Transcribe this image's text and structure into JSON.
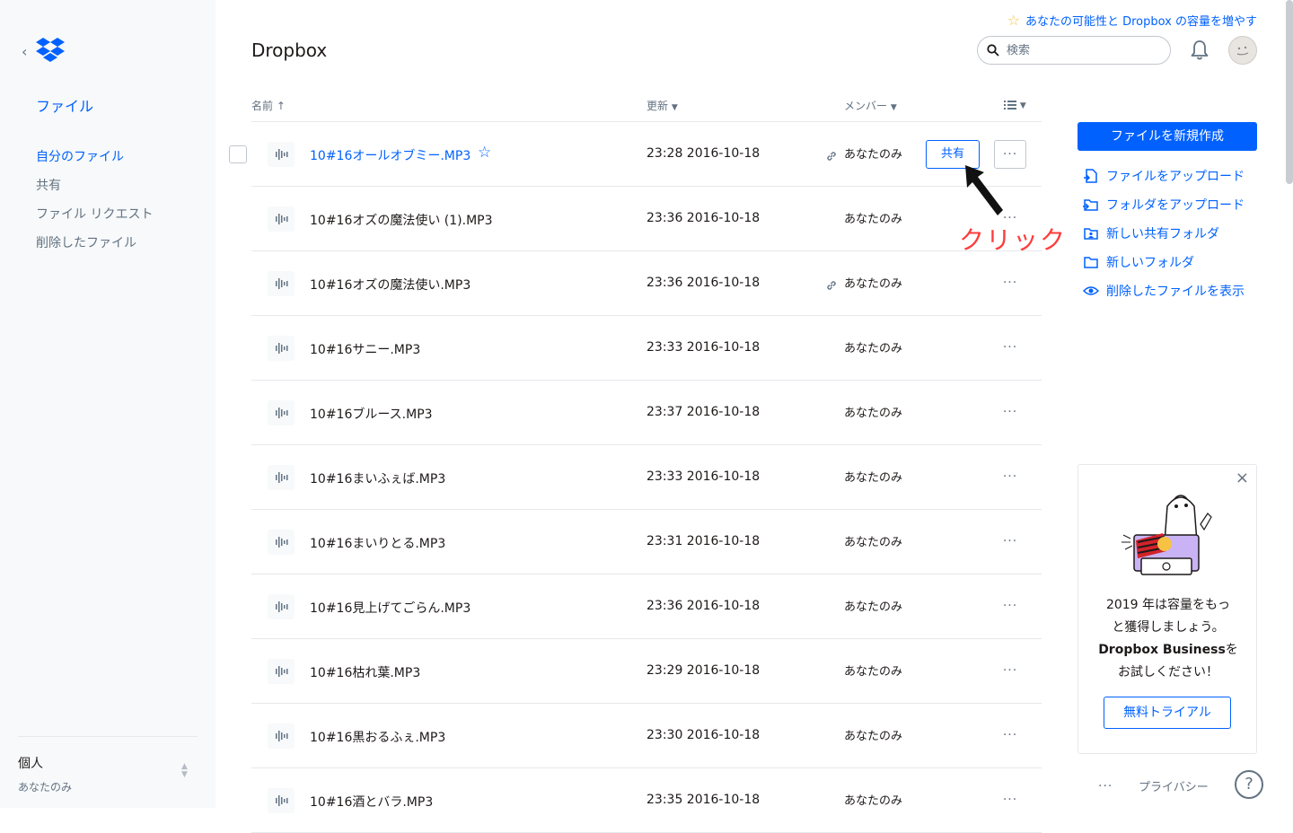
{
  "sidebar": {
    "title": "ファイル",
    "nav": [
      "自分のファイル",
      "共有",
      "ファイル リクエスト",
      "削除したファイル"
    ],
    "account_name": "個人",
    "account_sub": "あなたのみ"
  },
  "header": {
    "page_title": "Dropbox",
    "upsell": "あなたの可能性と Dropbox の容量を増やす",
    "search_placeholder": "検索"
  },
  "table": {
    "columns": {
      "name": "名前",
      "modified": "更新",
      "members": "メンバー"
    },
    "rows": [
      {
        "name": "10#16オールオブミー.MP3",
        "date": "23:28 2016-10-18",
        "member": "あなたのみ",
        "linked": true,
        "starred": true,
        "hover": true
      },
      {
        "name": "10#16オズの魔法使い (1).MP3",
        "date": "23:36 2016-10-18",
        "member": "あなたのみ",
        "linked": false
      },
      {
        "name": "10#16オズの魔法使い.MP3",
        "date": "23:36 2016-10-18",
        "member": "あなたのみ",
        "linked": true
      },
      {
        "name": "10#16サニー.MP3",
        "date": "23:33 2016-10-18",
        "member": "あなたのみ",
        "linked": false
      },
      {
        "name": "10#16ブルース.MP3",
        "date": "23:37 2016-10-18",
        "member": "あなたのみ",
        "linked": false
      },
      {
        "name": "10#16まいふぇば.MP3",
        "date": "23:33 2016-10-18",
        "member": "あなたのみ",
        "linked": false
      },
      {
        "name": "10#16まいりとる.MP3",
        "date": "23:31 2016-10-18",
        "member": "あなたのみ",
        "linked": false
      },
      {
        "name": "10#16見上げてごらん.MP3",
        "date": "23:36 2016-10-18",
        "member": "あなたのみ",
        "linked": false
      },
      {
        "name": "10#16枯れ葉.MP3",
        "date": "23:29 2016-10-18",
        "member": "あなたのみ",
        "linked": false
      },
      {
        "name": "10#16黒おるふぇ.MP3",
        "date": "23:30 2016-10-18",
        "member": "あなたのみ",
        "linked": false
      },
      {
        "name": "10#16酒とバラ.MP3",
        "date": "23:35 2016-10-18",
        "member": "あなたのみ",
        "linked": false
      }
    ],
    "share_label": "共有",
    "more_label": "..."
  },
  "annotation": {
    "text": "クリック"
  },
  "actions": {
    "new_file": "ファイルを新規作成",
    "items": [
      {
        "label": "ファイルをアップロード",
        "icon": "upload-file-icon"
      },
      {
        "label": "フォルダをアップロード",
        "icon": "upload-folder-icon"
      },
      {
        "label": "新しい共有フォルダ",
        "icon": "shared-folder-icon"
      },
      {
        "label": "新しいフォルダ",
        "icon": "folder-icon"
      },
      {
        "label": "削除したファイルを表示",
        "icon": "eye-icon"
      }
    ]
  },
  "promo": {
    "line1": "2019 年は容量をもっ",
    "line2": "と獲得しましょう。",
    "brand": "Dropbox Business",
    "line3_suffix": "を",
    "line4": "お試しください！",
    "button": "無料トライアル"
  },
  "footer": {
    "more": "...",
    "privacy": "プライバシー",
    "help": "?"
  },
  "colors": {
    "accent": "#0061fe",
    "annotation": "#ff3b3b",
    "sidebar_bg": "#f7f9fa"
  }
}
